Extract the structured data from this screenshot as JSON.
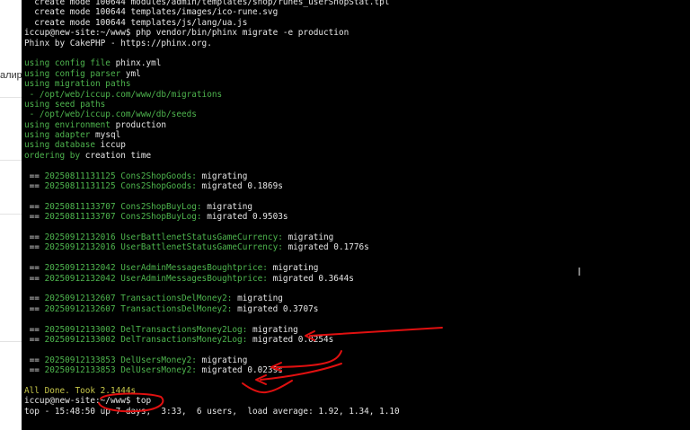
{
  "background": {
    "partial_text": "алиро"
  },
  "terminal": {
    "lines": [
      [
        {
          "c": "w",
          "t": "  create mode 100644 modules/admin/templates/shop/runes_userShopStat.tpl"
        }
      ],
      [
        {
          "c": "w",
          "t": "  create mode 100644 templates/images/ico-rune.svg"
        }
      ],
      [
        {
          "c": "w",
          "t": "  create mode 100644 templates/js/lang/ua.js"
        }
      ],
      [
        {
          "c": "w",
          "t": "iccup@new-site:~/www$ php vendor/bin/phinx migrate -e production"
        }
      ],
      [
        {
          "c": "w",
          "t": "Phinx by CakePHP - https://phinx.org."
        }
      ],
      [
        {
          "c": "w",
          "t": ""
        }
      ],
      [
        {
          "c": "g",
          "t": "using config file "
        },
        {
          "c": "w",
          "t": "phinx.yml"
        }
      ],
      [
        {
          "c": "g",
          "t": "using config parser "
        },
        {
          "c": "w",
          "t": "yml"
        }
      ],
      [
        {
          "c": "g",
          "t": "using migration paths"
        }
      ],
      [
        {
          "c": "g",
          "t": " - /opt/web/iccup.com/www/db/migrations"
        }
      ],
      [
        {
          "c": "g",
          "t": "using seed paths"
        }
      ],
      [
        {
          "c": "g",
          "t": " - /opt/web/iccup.com/www/db/seeds"
        }
      ],
      [
        {
          "c": "g",
          "t": "using environment "
        },
        {
          "c": "w",
          "t": "production"
        }
      ],
      [
        {
          "c": "g",
          "t": "using adapter "
        },
        {
          "c": "w",
          "t": "mysql"
        }
      ],
      [
        {
          "c": "g",
          "t": "using database "
        },
        {
          "c": "w",
          "t": "iccup"
        }
      ],
      [
        {
          "c": "g",
          "t": "ordering by "
        },
        {
          "c": "w",
          "t": "creation time"
        }
      ],
      [
        {
          "c": "w",
          "t": ""
        }
      ],
      [
        {
          "c": "w",
          "t": " == "
        },
        {
          "c": "g",
          "t": "20250811131125 Cons2ShopGoods:"
        },
        {
          "c": "w",
          "t": " migrating"
        }
      ],
      [
        {
          "c": "w",
          "t": " == "
        },
        {
          "c": "g",
          "t": "20250811131125 Cons2ShopGoods:"
        },
        {
          "c": "w",
          "t": " migrated 0.1869s"
        }
      ],
      [
        {
          "c": "w",
          "t": ""
        }
      ],
      [
        {
          "c": "w",
          "t": " == "
        },
        {
          "c": "g",
          "t": "20250811133707 Cons2ShopBuyLog:"
        },
        {
          "c": "w",
          "t": " migrating"
        }
      ],
      [
        {
          "c": "w",
          "t": " == "
        },
        {
          "c": "g",
          "t": "20250811133707 Cons2ShopBuyLog:"
        },
        {
          "c": "w",
          "t": " migrated 0.9503s"
        }
      ],
      [
        {
          "c": "w",
          "t": ""
        }
      ],
      [
        {
          "c": "w",
          "t": " == "
        },
        {
          "c": "g",
          "t": "20250912132016 UserBattlenetStatusGameCurrency:"
        },
        {
          "c": "w",
          "t": " migrating"
        }
      ],
      [
        {
          "c": "w",
          "t": " == "
        },
        {
          "c": "g",
          "t": "20250912132016 UserBattlenetStatusGameCurrency:"
        },
        {
          "c": "w",
          "t": " migrated 0.1776s"
        }
      ],
      [
        {
          "c": "w",
          "t": ""
        }
      ],
      [
        {
          "c": "w",
          "t": " == "
        },
        {
          "c": "g",
          "t": "20250912132042 UserAdminMessagesBoughtprice:"
        },
        {
          "c": "w",
          "t": " migrating"
        }
      ],
      [
        {
          "c": "w",
          "t": " == "
        },
        {
          "c": "g",
          "t": "20250912132042 UserAdminMessagesBoughtprice:"
        },
        {
          "c": "w",
          "t": " migrated 0.3644s"
        }
      ],
      [
        {
          "c": "w",
          "t": ""
        }
      ],
      [
        {
          "c": "w",
          "t": " == "
        },
        {
          "c": "g",
          "t": "20250912132607 TransactionsDelMoney2:"
        },
        {
          "c": "w",
          "t": " migrating"
        }
      ],
      [
        {
          "c": "w",
          "t": " == "
        },
        {
          "c": "g",
          "t": "20250912132607 TransactionsDelMoney2:"
        },
        {
          "c": "w",
          "t": " migrated 0.3707s"
        }
      ],
      [
        {
          "c": "w",
          "t": ""
        }
      ],
      [
        {
          "c": "w",
          "t": " == "
        },
        {
          "c": "g",
          "t": "20250912133002 DelTransactionsMoney2Log:"
        },
        {
          "c": "w",
          "t": " migrating"
        }
      ],
      [
        {
          "c": "w",
          "t": " == "
        },
        {
          "c": "g",
          "t": "20250912133002 DelTransactionsMoney2Log:"
        },
        {
          "c": "w",
          "t": " migrated 0.0254s"
        }
      ],
      [
        {
          "c": "w",
          "t": ""
        }
      ],
      [
        {
          "c": "w",
          "t": " == "
        },
        {
          "c": "g",
          "t": "20250912133853 DelUsersMoney2:"
        },
        {
          "c": "w",
          "t": " migrating"
        }
      ],
      [
        {
          "c": "w",
          "t": " == "
        },
        {
          "c": "g",
          "t": "20250912133853 DelUsersMoney2:"
        },
        {
          "c": "w",
          "t": " migrated 0.0239s"
        }
      ],
      [
        {
          "c": "w",
          "t": ""
        }
      ],
      [
        {
          "c": "y",
          "t": "All Done. Took 2.1444s"
        }
      ],
      [
        {
          "c": "w",
          "t": "iccup@new-site:~/www$ top"
        }
      ],
      [
        {
          "c": "w",
          "t": "top - 15:48:50 up 7 days,  3:33,  6 users,  load average: 1.92, 1.34, 1.10"
        }
      ]
    ]
  },
  "colors": {
    "terminal_bg": "#000000",
    "text": "#d7d7d7",
    "green": "#4eb54e",
    "yellow": "#c8c84a",
    "annotation": "#e01010"
  },
  "icons": {
    "cursor": "i-beam-cursor-icon"
  }
}
